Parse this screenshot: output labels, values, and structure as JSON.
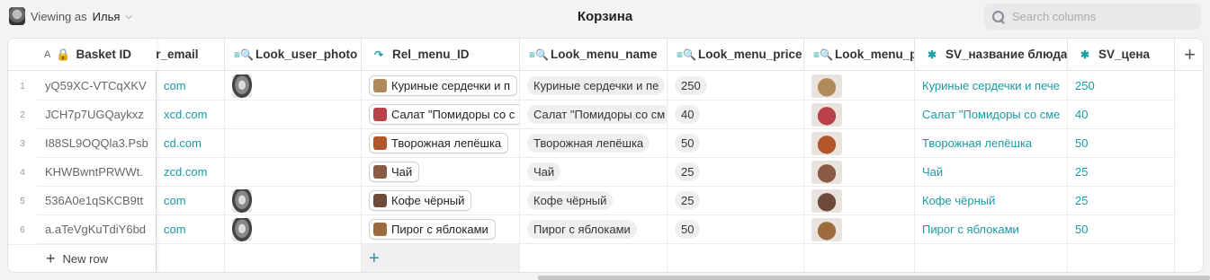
{
  "header": {
    "viewing_prefix": "Viewing as",
    "viewing_user": "Илья",
    "title": "Корзина",
    "search_placeholder": "Search columns"
  },
  "colors": {
    "accent": "#1a9aa3",
    "lookup_icon": "#1aa0a6"
  },
  "columns": [
    {
      "label": "Basket ID",
      "icon": "lock-icon"
    },
    {
      "label": "user_email",
      "icon": "lookup-icon"
    },
    {
      "label": "Look_user_photo",
      "icon": "lookup-icon"
    },
    {
      "label": "Rel_menu_ID",
      "icon": "relation-arrow-icon"
    },
    {
      "label": "Look_menu_name",
      "icon": "lookup-icon"
    },
    {
      "label": "Look_menu_price",
      "icon": "lookup-icon"
    },
    {
      "label": "Look_menu_photo",
      "icon": "lookup-icon"
    },
    {
      "label": "SV_название блюда",
      "icon": "asterisk-icon"
    },
    {
      "label": "SV_цена",
      "icon": "asterisk-icon"
    }
  ],
  "rows": [
    {
      "n": "1",
      "basket_id": "yQ59XC-VTCqXKV",
      "email": "com",
      "has_photo": true,
      "menu_id": "Куриные сердечки и п",
      "menu_name": "Куриные сердечки и пе",
      "price": "250",
      "sv_name": "Куриные сердечки и пече",
      "sv_price": "250",
      "food_color": "#b08a5a"
    },
    {
      "n": "2",
      "basket_id": "JCH7p7UGQaykxz",
      "email": "xcd.com",
      "has_photo": false,
      "menu_id": "Салат \"Помидоры со с",
      "menu_name": "Салат \"Помидоры со см",
      "price": "40",
      "sv_name": "Салат \"Помидоры со сме",
      "sv_price": "40",
      "food_color": "#b8414a"
    },
    {
      "n": "3",
      "basket_id": "I88SL9OQQla3.Psb",
      "email": "cd.com",
      "has_photo": false,
      "menu_id": "Творожная лепёшка",
      "menu_name": "Творожная лепёшка",
      "price": "50",
      "sv_name": "Творожная лепёшка",
      "sv_price": "50",
      "food_color": "#b3562c"
    },
    {
      "n": "4",
      "basket_id": "KHWBwntPRWWt.",
      "email": "zcd.com",
      "has_photo": false,
      "menu_id": "Чай",
      "menu_name": "Чай",
      "price": "25",
      "sv_name": "Чай",
      "sv_price": "25",
      "food_color": "#8a5a45"
    },
    {
      "n": "5",
      "basket_id": "536A0e1qSKCB9tt",
      "email": "com",
      "has_photo": true,
      "menu_id": "Кофе чёрный",
      "menu_name": "Кофе чёрный",
      "price": "25",
      "sv_name": "Кофе чёрный",
      "sv_price": "25",
      "food_color": "#6e4a3a"
    },
    {
      "n": "6",
      "basket_id": "a.aTeVgKuTdiY6bd",
      "email": "com",
      "has_photo": true,
      "menu_id": "Пирог с яблоками",
      "menu_name": "Пирог с яблоками",
      "price": "50",
      "sv_name": "Пирог с яблоками",
      "sv_price": "50",
      "food_color": "#9c6a3e"
    }
  ],
  "footer": {
    "new_row_label": "New row",
    "add_relation_symbol": "+"
  },
  "add_column_symbol": "+"
}
